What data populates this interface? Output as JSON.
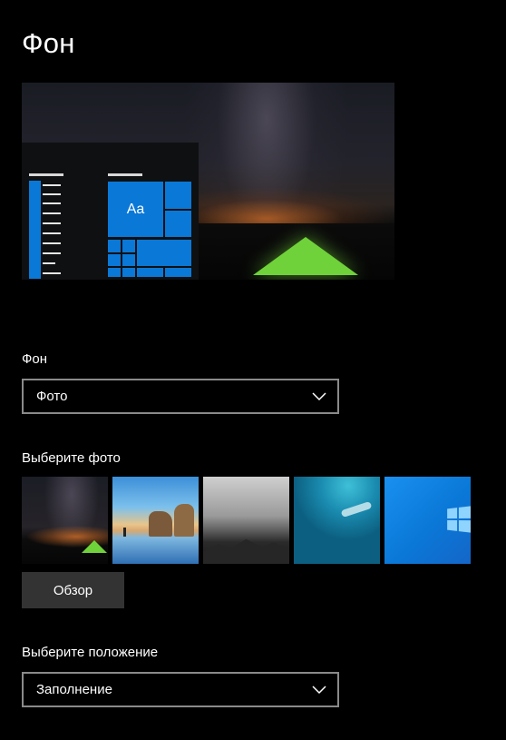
{
  "page": {
    "title": "Фон"
  },
  "preview": {
    "tile_text": "Aa"
  },
  "background_section": {
    "label": "Фон",
    "dropdown_value": "Фото"
  },
  "photo_section": {
    "label": "Выберите фото",
    "thumbnails": [
      {
        "name": "night-sky-tent"
      },
      {
        "name": "beach-rocks"
      },
      {
        "name": "grey-mountains"
      },
      {
        "name": "underwater-swimmer"
      },
      {
        "name": "windows-blue"
      }
    ],
    "browse_label": "Обзор"
  },
  "position_section": {
    "label": "Выберите положение",
    "dropdown_value": "Заполнение"
  },
  "colors": {
    "background": "#000000",
    "accent": "#0a78d7",
    "dropdown_border": "#8a8a8a",
    "button_bg": "#333333"
  },
  "icons": {
    "dropdown_chevron": "chevron-down-icon"
  }
}
